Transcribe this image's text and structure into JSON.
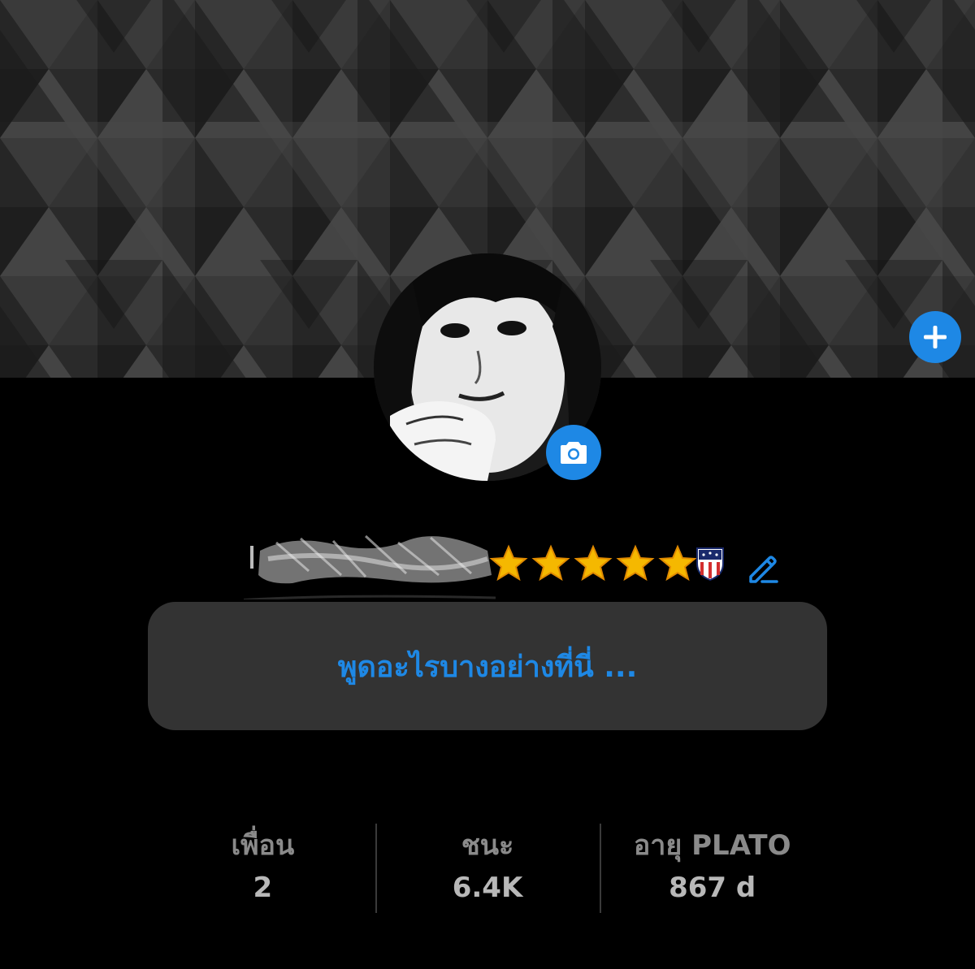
{
  "profile": {
    "status_placeholder": "พูดอะไรบางอย่างที่นี่ ...",
    "star_count": 5,
    "badge_icon": "shield-flag-icon"
  },
  "stats": [
    {
      "label": "เพื่อน",
      "value": "2"
    },
    {
      "label": "ชนะ",
      "value": "6.4K"
    },
    {
      "label": "อายุ PLATO",
      "value": "867 d"
    }
  ],
  "colors": {
    "accent": "#1e88e5",
    "background": "#000000",
    "status_box": "#333333",
    "stat_label": "#8a8a8a",
    "stat_value": "#b8b8b8",
    "star": "#f5b800"
  },
  "icons": {
    "add": "plus-icon",
    "camera": "camera-icon",
    "edit": "pencil-icon"
  }
}
